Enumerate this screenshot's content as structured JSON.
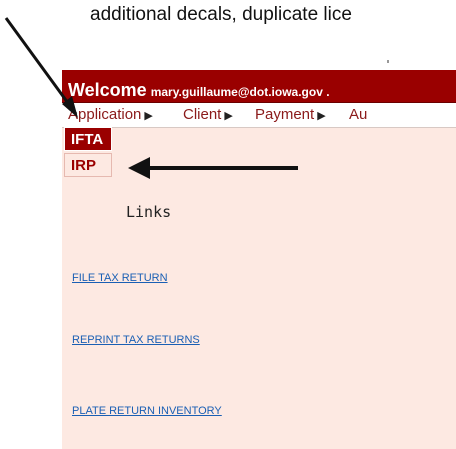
{
  "caption": "additional decals, duplicate lice",
  "banner": {
    "welcome_word": "Welcome",
    "email": "mary.guillaume@dot.iowa.gov ."
  },
  "menu": {
    "items": [
      {
        "label": "Application"
      },
      {
        "label": "Client"
      },
      {
        "label": "Payment"
      },
      {
        "label": "Au"
      }
    ]
  },
  "dropdown": {
    "items": [
      {
        "label": "IFTA"
      },
      {
        "label": "IRP"
      }
    ]
  },
  "quick_links_title": "Links",
  "links": [
    "FILE TAX RETURN",
    "REPRINT TAX RETURNS",
    "PLATE RETURN INVENTORY"
  ],
  "colors": {
    "banner": "#9a0000",
    "page_background": "#fde9e2",
    "link": "#1a5fb4",
    "menu_text": "#8b1a1a"
  },
  "icons": {
    "menu_submenu_arrow": "triangle-right-icon",
    "annotation_arrows": "arrow-icon"
  }
}
